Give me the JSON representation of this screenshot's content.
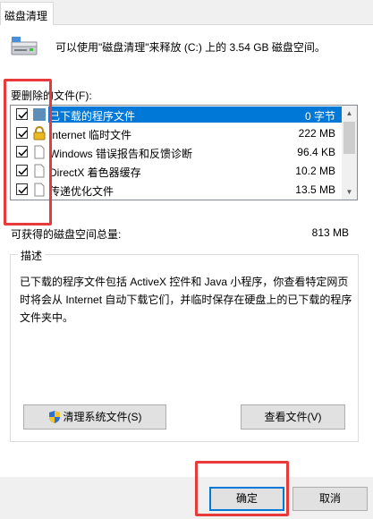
{
  "window": {
    "tab_label": "磁盘清理"
  },
  "header": {
    "text": "可以使用\"磁盘清理\"来释放  (C:) 上的 3.54 GB 磁盘空间。"
  },
  "files_section": {
    "label": "要删除的文件(F):"
  },
  "file_list": [
    {
      "name": "已下载的程序文件",
      "size": "0 字节",
      "checked": true,
      "selected": true,
      "icon": "folder-icon"
    },
    {
      "name": "Internet 临时文件",
      "size": "222 MB",
      "checked": true,
      "selected": false,
      "icon": "lock-icon"
    },
    {
      "name": "Windows 错误报告和反馈诊断",
      "size": "96.4 KB",
      "checked": true,
      "selected": false,
      "icon": "file-icon"
    },
    {
      "name": "DirectX 着色器缓存",
      "size": "10.2 MB",
      "checked": true,
      "selected": false,
      "icon": "file-icon"
    },
    {
      "name": "传递优化文件",
      "size": "13.5 MB",
      "checked": true,
      "selected": false,
      "icon": "file-icon"
    }
  ],
  "total": {
    "label": "可获得的磁盘空间总量:",
    "value": "813 MB"
  },
  "description": {
    "title": "描述",
    "text": "已下载的程序文件包括 ActiveX 控件和 Java 小程序，你查看特定网页时将会从 Internet 自动下载它们，并临时保存在硬盘上的已下载的程序文件夹中。"
  },
  "buttons": {
    "cleanup_system": "清理系统文件(S)",
    "view_files": "查看文件(V)",
    "ok": "确定",
    "cancel": "取消"
  },
  "colors": {
    "selection": "#0078d7",
    "highlight_box": "#e83a3a"
  }
}
